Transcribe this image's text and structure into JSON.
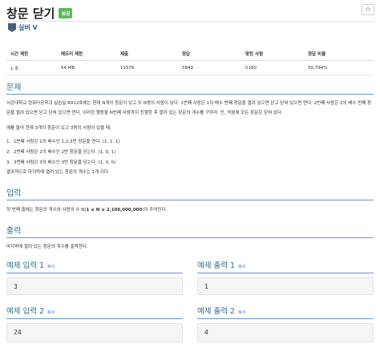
{
  "problem": {
    "title": "창문 닫기",
    "badge": "성공",
    "star_icon": "☆",
    "tier": "실버 V"
  },
  "info": {
    "headers": [
      "시간 제한",
      "메모리 제한",
      "제출",
      "정답",
      "맞힌 사람",
      "정답 비율"
    ],
    "values": [
      "1 초",
      "64 MB",
      "11576",
      "5849",
      "5180",
      "50.794%"
    ]
  },
  "sections": {
    "problem_title": "문제",
    "problem_p1": "서강대학교 컴퓨터공학과 실습실 R912호에는 현재 N개의 창문이 있고 또 N명의 사람이 있다. 1번째 사람은 1의 배수 번째 창문을 열려 있으면 닫고 닫혀 있으면 연다. 2번째 사람은 2의 배수 번째 창문을 열려 있으면 닫고 닫혀 있으면 연다. 이러한 행동을 N번째 사람까지 진행한 후 열려 있는 창문의 개수를 구하라. 단, 처음에 모든 창문은 닫혀 있다.",
    "problem_p2": "예를 들어 현재 3개의 창문이 있고 3명의 사람이 있을 때,",
    "list": [
      {
        "num": "1.",
        "text": "1번째 사람은 1의 배수인 1,2,3번 창문을 연다. (1, 1, 1)"
      },
      {
        "num": "2.",
        "text": "2번째 사람은 2의 배수인 2번 창문을 닫는다. (1, 0, 1)"
      },
      {
        "num": "3.",
        "text": "3번째 사람은 3의 배수인 3번 창문을 닫는다. (1, 0, 0)"
      }
    ],
    "problem_p3": "결과적으로 마지막에 열려 있는 창문의 개수는 1개 이다.",
    "input_title": "입력",
    "input_text_a": "첫 번째 줄에는 창문의 개수와 사람의 수 N(",
    "input_text_b": "1 ≤ N ≤ 2,100,000,000",
    "input_text_c": ")이 주어진다.",
    "output_title": "출력",
    "output_text": "마지막에 열려 있는 창문의 개수를 출력한다."
  },
  "examples": [
    {
      "in_title": "예제 입력 1",
      "out_title": "예제 출력 1",
      "copy": "복사",
      "input": "3",
      "output": "1"
    },
    {
      "in_title": "예제 입력 2",
      "out_title": "예제 출력 2",
      "copy": "복사",
      "input": "24",
      "output": "4"
    }
  ],
  "colors": {
    "accent": "#31708f",
    "badge": "#5cb85c",
    "link": "#3b6fb6"
  }
}
